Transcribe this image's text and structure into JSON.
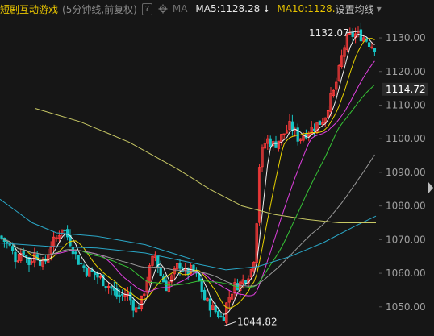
{
  "header": {
    "title": "短剧互动游戏",
    "subtitle": "(5分钟线,前复权)",
    "help_label": "?",
    "ma_label": "MA",
    "ma5_label": "MA5:1128.28",
    "ma5_arrow": "↓",
    "ma10_label": "MA10:1128.",
    "settings_label": "设置均线",
    "caret": "▼"
  },
  "colors": {
    "background": "#161616",
    "up": "#ff3b3b",
    "down": "#16c4c4",
    "ma5": "#f0f0f0",
    "ma10": "#e8d200",
    "ma20": "#e040e0",
    "ma30": "#36c436",
    "ma60": "#9a9a9a",
    "ma120": "#2aa7c7",
    "ma250": "#c8c864"
  },
  "chart_data": {
    "type": "candlestick",
    "y_range": [
      1043,
      1136
    ],
    "y_ticks": [
      "1130.00",
      "1120.00",
      "1110.00",
      "1100.00",
      "1090.00",
      "1080.00",
      "1070.00",
      "1060.00",
      "1050.00"
    ],
    "current_price_label": "1114.72",
    "current_price": 1114.72,
    "high_label": "1132.07",
    "high": 1132.07,
    "low_label": "1044.82",
    "low": 1044.82,
    "grid": false
  }
}
